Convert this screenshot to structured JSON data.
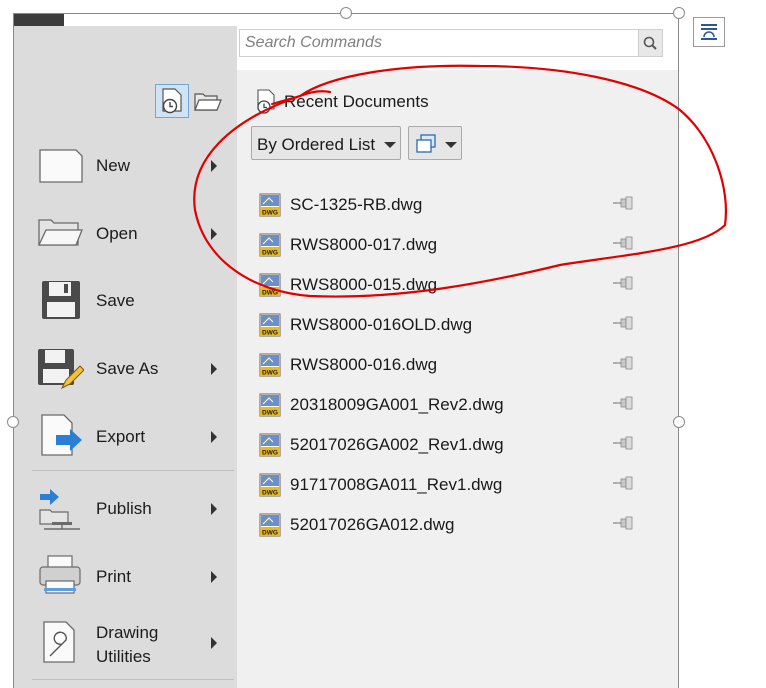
{
  "search": {
    "placeholder": "Search Commands"
  },
  "recent": {
    "title": "Recent Documents",
    "order_label": "By Ordered List"
  },
  "menu": {
    "items": [
      {
        "label": "New",
        "icon": "new-document-icon",
        "has_submenu": true
      },
      {
        "label": "Open",
        "icon": "open-folder-icon",
        "has_submenu": true
      },
      {
        "label": "Save",
        "icon": "floppy-disk-icon",
        "has_submenu": false
      },
      {
        "label": "Save As",
        "icon": "save-as-icon",
        "has_submenu": true
      },
      {
        "label": "Export",
        "icon": "export-icon",
        "has_submenu": true
      },
      {
        "label": "Publish",
        "icon": "publish-icon",
        "has_submenu": true
      },
      {
        "label": "Print",
        "icon": "printer-icon",
        "has_submenu": true
      },
      {
        "label_line1": "Drawing",
        "label_line2": "Utilities",
        "icon": "wrench-icon",
        "has_submenu": true
      }
    ]
  },
  "files": [
    "SC-1325-RB.dwg",
    "RWS8000-017.dwg",
    "RWS8000-015.dwg",
    "RWS8000-016OLD.dwg",
    "RWS8000-016.dwg",
    "20318009GA001_Rev2.dwg",
    "52017026GA002_Rev1.dwg",
    "91717008GA011_Rev1.dwg",
    "52017026GA012.dwg"
  ],
  "colors": {
    "menu_bg": "#dcdcdc",
    "panel_bg": "#f0f0f0",
    "selected_toggle": "#cfe3f5",
    "annotation": "#e00000",
    "dwg_badge": "#e8b820"
  }
}
